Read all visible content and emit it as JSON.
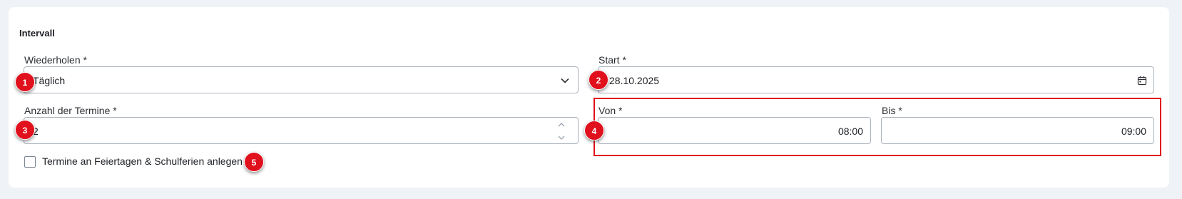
{
  "section": {
    "title": "Intervall"
  },
  "repeat": {
    "label": "Wiederholen",
    "required_mark": "*",
    "value": "Täglich"
  },
  "start": {
    "label": "Start",
    "required_mark": "*",
    "value": "28.10.2025"
  },
  "count": {
    "label": "Anzahl der Termine",
    "required_mark": "*",
    "value": "2"
  },
  "from": {
    "label": "Von",
    "required_mark": "*",
    "value": "08:00"
  },
  "to": {
    "label": "Bis",
    "required_mark": "*",
    "value": "09:00"
  },
  "holiday_option": {
    "label": "Termine an Feiertagen & Schulferien anlegen",
    "checked": false
  },
  "markers": [
    "1",
    "2",
    "3",
    "4",
    "5"
  ],
  "colors": {
    "marker": "#e0101c",
    "highlight_border": "#e0101c",
    "field_border": "#aab2bd",
    "page_background": "#eff2f6"
  }
}
